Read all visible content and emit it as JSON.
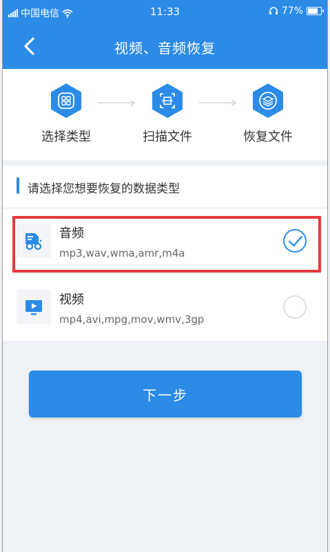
{
  "status_bar": {
    "left_text": "中国电信",
    "time": "11:33",
    "battery": "77%"
  },
  "header": {
    "title": "视频、音频恢复"
  },
  "steps": [
    {
      "label": "选择类型",
      "icon": "grid-icon"
    },
    {
      "label": "扫描文件",
      "icon": "scan-icon"
    },
    {
      "label": "恢复文件",
      "icon": "layers-icon"
    }
  ],
  "section": {
    "title": "请选择您想要恢复的数据类型"
  },
  "options": [
    {
      "name": "音频",
      "formats": "mp3,wav,wma,amr,m4a",
      "icon": "audio-file-icon",
      "selected": true
    },
    {
      "name": "视频",
      "formats": "mp4,avi,mpg,mov,wmv,3gp",
      "icon": "video-icon",
      "selected": false
    }
  ],
  "next_button": {
    "label": "下一步"
  },
  "colors": {
    "brand": "#2c8be7",
    "highlight": "#e8383d"
  }
}
